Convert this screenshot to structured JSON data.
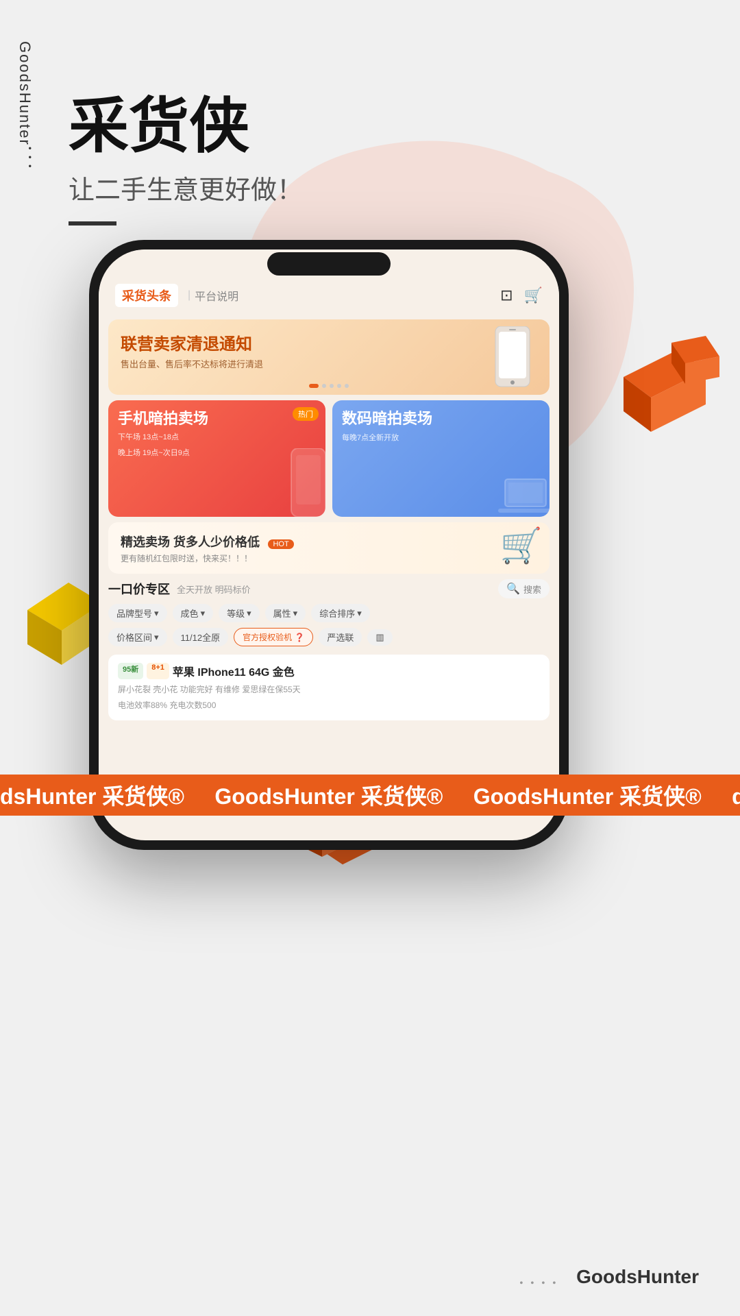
{
  "app": {
    "brand_vertical": "GoodsHunter．．．",
    "main_title": "采货侠",
    "subtitle": "让二手生意更好做！",
    "footer_dots": "．．．．",
    "footer_brand": "GoodsHunter"
  },
  "phone_screen": {
    "nav": {
      "tab_active": "采货头条",
      "tab_normal": "平台说明",
      "icon_scan": "⊡",
      "icon_cart": "⊓"
    },
    "banner": {
      "title": "联营卖家清退通知",
      "subtitle": "售出台量、售后率不达标将进行清退",
      "dots": [
        "active",
        "",
        "",
        "",
        ""
      ]
    },
    "card_red": {
      "hot_badge": "热门",
      "title": "手机暗拍卖场",
      "desc_line1": "下午场 13点~18点",
      "desc_line2": "晚上场 19点~次日9点"
    },
    "card_blue": {
      "title": "数码暗拍卖场",
      "desc": "每晚7点全新开放"
    },
    "sale_banner": {
      "title": "精选卖场  货多人少价格低",
      "hot_badge": "HOT",
      "subtitle": "更有随机红包限时送，快来买！！！"
    },
    "fixed_price": {
      "title": "一口价专区",
      "desc": "全天开放 明码标价",
      "search_label": "搜索"
    },
    "filters1": [
      "品牌型号▼",
      "成色▼",
      "等级▼",
      "属性▼",
      "综合排序▼"
    ],
    "filters2": [
      "价格区间▼",
      "11/12全原",
      "官方授权验机❓",
      "严选联",
      "▥"
    ],
    "active_filter": "官方授权验机❓",
    "product": {
      "tag1": "95新",
      "tag2": "8+1",
      "name": "苹果 IPhone11 64G 金色",
      "attrs_line1": "屏小花裂  壳小花  功能完好  有维修  爱思绿在保55天",
      "attrs_line2": "电池效率88%  充电次数500"
    }
  },
  "bottom_banner_text": "dsHunter 采货侠®   GoodsHunter 采货侠®   Goo"
}
